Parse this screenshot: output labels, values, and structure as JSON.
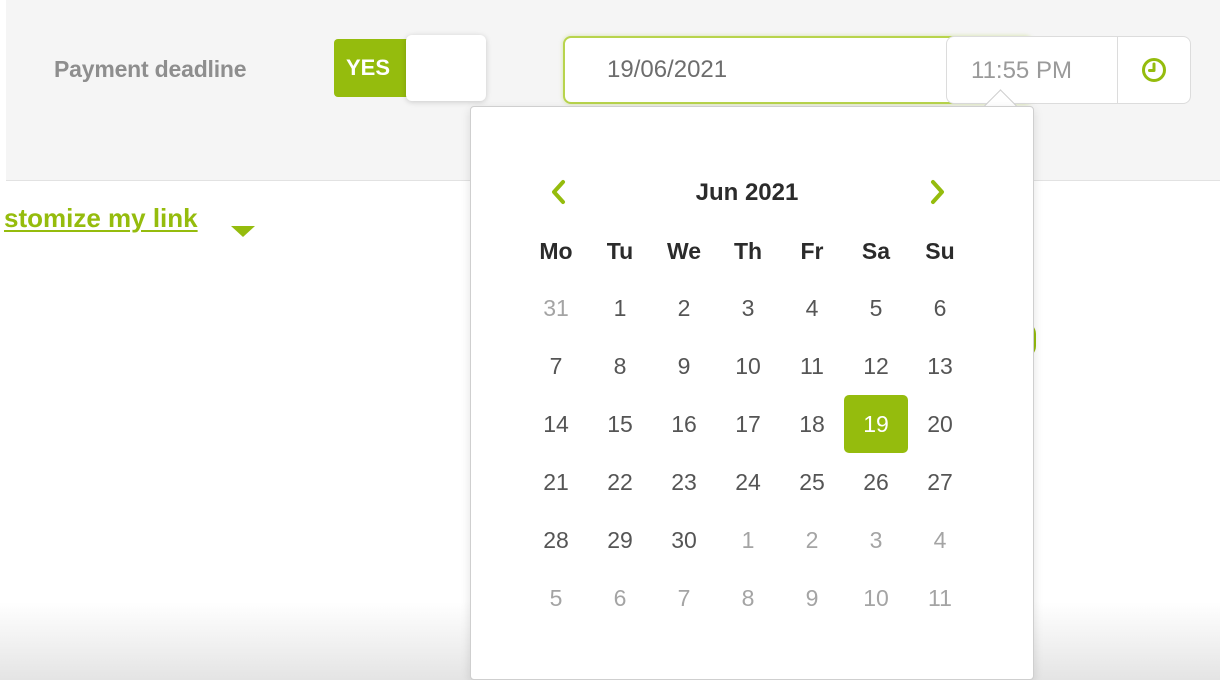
{
  "colors": {
    "accent": "#95bc0d",
    "label_gray": "#8e8e8e",
    "band_bg": "#f5f5f5"
  },
  "deadline": {
    "label": "Payment deadline",
    "toggle_on_label": "YES",
    "date_value": "19/06/2021",
    "time_value": "11:55 PM",
    "clock_icon": "clock-icon"
  },
  "customize": {
    "link_label": "stomize my link"
  },
  "datepicker": {
    "month_title": "Jun 2021",
    "prev_icon": "chevron-left-icon",
    "next_icon": "chevron-right-icon",
    "weekdays": [
      "Mo",
      "Tu",
      "We",
      "Th",
      "Fr",
      "Sa",
      "Su"
    ],
    "weeks": [
      [
        {
          "d": "31",
          "m": true
        },
        {
          "d": "1"
        },
        {
          "d": "2"
        },
        {
          "d": "3"
        },
        {
          "d": "4"
        },
        {
          "d": "5"
        },
        {
          "d": "6"
        }
      ],
      [
        {
          "d": "7"
        },
        {
          "d": "8"
        },
        {
          "d": "9"
        },
        {
          "d": "10"
        },
        {
          "d": "11"
        },
        {
          "d": "12"
        },
        {
          "d": "13"
        }
      ],
      [
        {
          "d": "14"
        },
        {
          "d": "15"
        },
        {
          "d": "16"
        },
        {
          "d": "17"
        },
        {
          "d": "18"
        },
        {
          "d": "19",
          "sel": true
        },
        {
          "d": "20"
        }
      ],
      [
        {
          "d": "21"
        },
        {
          "d": "22"
        },
        {
          "d": "23"
        },
        {
          "d": "24"
        },
        {
          "d": "25"
        },
        {
          "d": "26"
        },
        {
          "d": "27"
        }
      ],
      [
        {
          "d": "28"
        },
        {
          "d": "29"
        },
        {
          "d": "30"
        },
        {
          "d": "1",
          "m": true
        },
        {
          "d": "2",
          "m": true
        },
        {
          "d": "3",
          "m": true
        },
        {
          "d": "4",
          "m": true
        }
      ],
      [
        {
          "d": "5",
          "m": true
        },
        {
          "d": "6",
          "m": true
        },
        {
          "d": "7",
          "m": true
        },
        {
          "d": "8",
          "m": true
        },
        {
          "d": "9",
          "m": true
        },
        {
          "d": "10",
          "m": true
        },
        {
          "d": "11",
          "m": true
        }
      ]
    ]
  }
}
